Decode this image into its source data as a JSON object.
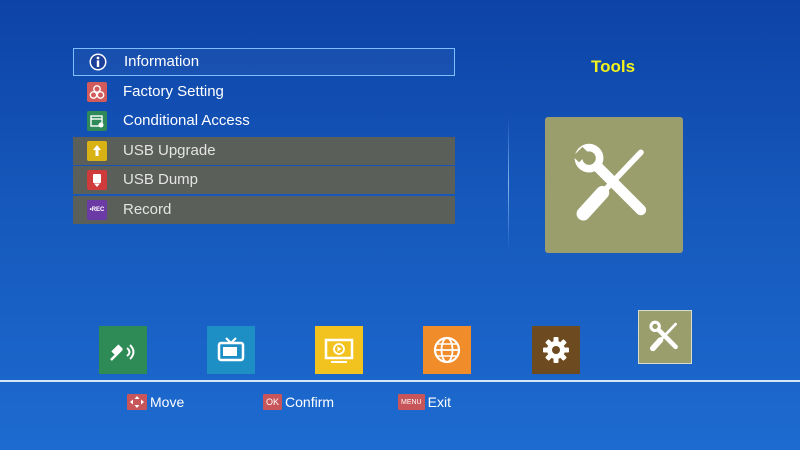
{
  "menu": {
    "items": [
      {
        "label": "Information",
        "icon": "info-icon",
        "icon_color": "#1c3f9a",
        "state": "selected"
      },
      {
        "label": "Factory Setting",
        "icon": "factory-reset-icon",
        "icon_color": "#d25a5a",
        "state": "normal"
      },
      {
        "label": "Conditional Access",
        "icon": "card-access-icon",
        "icon_color": "#2f8a5a",
        "state": "normal"
      },
      {
        "label": "USB Upgrade",
        "icon": "usb-upgrade-icon",
        "icon_color": "#d9b215",
        "state": "disabled"
      },
      {
        "label": "USB Dump",
        "icon": "usb-dump-icon",
        "icon_color": "#cf3b3b",
        "state": "disabled"
      },
      {
        "label": "Record",
        "icon": "record-icon",
        "icon_color": "#6c3aa5",
        "state": "disabled",
        "badge": "•REC"
      }
    ]
  },
  "panel": {
    "title": "Tools",
    "preview_icon": "tools-icon",
    "preview_color": "#9a9e6c"
  },
  "apps": [
    {
      "name": "satellite",
      "icon": "satellite-icon",
      "color": "#2f8b55"
    },
    {
      "name": "tv",
      "icon": "tv-icon",
      "color": "#1e8fc5"
    },
    {
      "name": "media",
      "icon": "media-icon",
      "color": "#f2c21e"
    },
    {
      "name": "network",
      "icon": "globe-icon",
      "color": "#f08c2a"
    },
    {
      "name": "settings",
      "icon": "gear-icon",
      "color": "#6d4a1f"
    },
    {
      "name": "tools",
      "icon": "tools-icon",
      "color": "#9a9e6c",
      "active": true
    }
  ],
  "hints": {
    "move": {
      "label": "Move",
      "key_icon": "arrows-icon"
    },
    "confirm": {
      "label": "Confirm",
      "key": "OK"
    },
    "exit": {
      "label": "Exit",
      "key": "MENU"
    }
  },
  "colors": {
    "title": "#f4f11b",
    "selection_border": "#7dc0ff",
    "disabled_row": "#5b5f5a",
    "key_bg": "#c8555a"
  }
}
